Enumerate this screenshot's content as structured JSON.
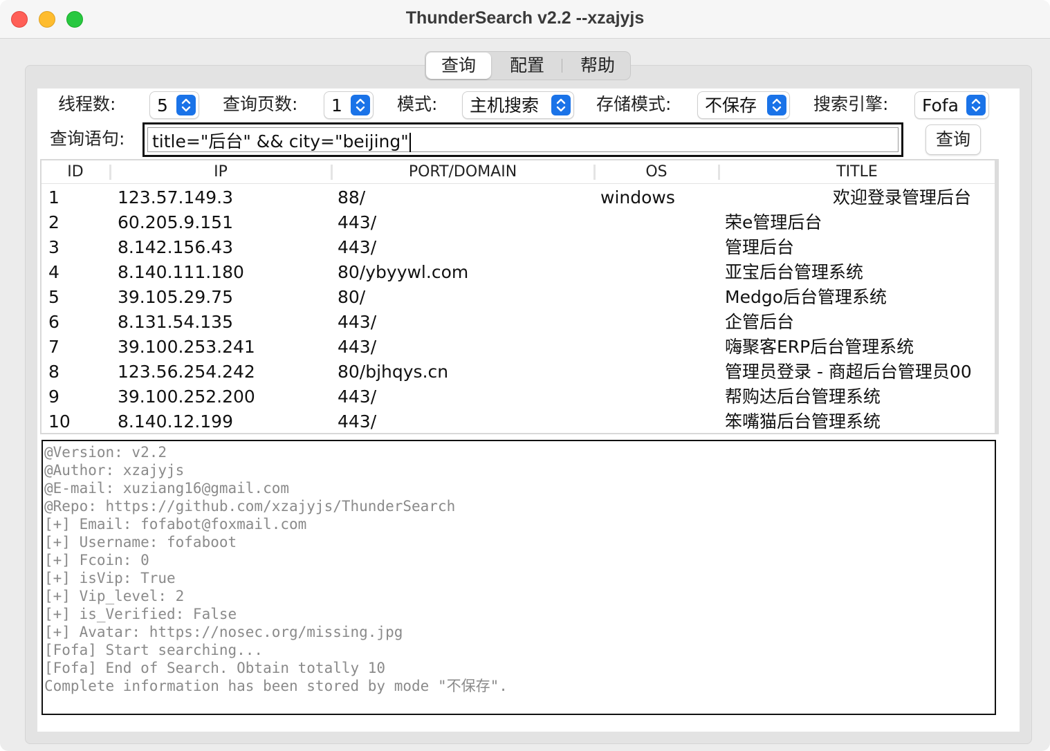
{
  "window": {
    "title": "ThunderSearch v2.2  --xzajyjs"
  },
  "tabs": [
    {
      "label": "查询"
    },
    {
      "label": "配置"
    },
    {
      "label": "帮助"
    }
  ],
  "controls": {
    "threads": {
      "label": "线程数:",
      "value": "5"
    },
    "pages": {
      "label": "查询页数:",
      "value": "1"
    },
    "mode": {
      "label": "模式:",
      "value": "主机搜索"
    },
    "storage": {
      "label": "存储模式:",
      "value": "不保存"
    },
    "engine": {
      "label": "搜索引擎:",
      "value": "Fofa"
    },
    "query": {
      "label": "查询语句:",
      "value": "title=\"后台\" && city=\"beijing\""
    },
    "search_button": "查询"
  },
  "table": {
    "columns": [
      "ID",
      "IP",
      "PORT/DOMAIN",
      "OS",
      "TITLE"
    ],
    "rows": [
      {
        "id": "1",
        "ip": "123.57.149.3",
        "port": "88/",
        "os": "windows",
        "title": "欢迎登录管理后台"
      },
      {
        "id": "2",
        "ip": "60.205.9.151",
        "port": "443/",
        "os": "",
        "title": "荣e管理后台"
      },
      {
        "id": "3",
        "ip": "8.142.156.43",
        "port": "443/",
        "os": "",
        "title": "管理后台"
      },
      {
        "id": "4",
        "ip": "8.140.111.180",
        "port": "80/ybyywl.com",
        "os": "",
        "title": "亚宝后台管理系统"
      },
      {
        "id": "5",
        "ip": "39.105.29.75",
        "port": "80/",
        "os": "",
        "title": "Medgo后台管理系统"
      },
      {
        "id": "6",
        "ip": "8.131.54.135",
        "port": "443/",
        "os": "",
        "title": "企管后台"
      },
      {
        "id": "7",
        "ip": "39.100.253.241",
        "port": "443/",
        "os": "",
        "title": "嗨聚客ERP后台管理系统"
      },
      {
        "id": "8",
        "ip": "123.56.254.242",
        "port": "80/bjhqys.cn",
        "os": "",
        "title": "管理员登录 - 商超后台管理员00"
      },
      {
        "id": "9",
        "ip": "39.100.252.200",
        "port": "443/",
        "os": "",
        "title": "帮购达后台管理系统"
      },
      {
        "id": "10",
        "ip": "8.140.12.199",
        "port": "443/",
        "os": "",
        "title": "笨嘴猫后台管理系统"
      }
    ]
  },
  "log": [
    "@Version: v2.2",
    "@Author: xzajyjs",
    "@E-mail: xuziang16@gmail.com",
    "@Repo: https://github.com/xzajyjs/ThunderSearch",
    "[+] Email: fofabot@foxmail.com",
    "[+] Username: fofaboot",
    "[+] Fcoin: 0",
    "[+] isVip: True",
    "[+] Vip_level: 2",
    "[+] is_Verified: False",
    "[+] Avatar: https://nosec.org/missing.jpg",
    "[Fofa] Start searching...",
    "[Fofa] End of Search. Obtain totally 10",
    "Complete information has been stored by mode \"不保存\"."
  ],
  "colors": {
    "accent": "#1a73e8",
    "close": "#ff5f57",
    "minimize": "#febc2e",
    "zoom": "#28c840",
    "log_text": "#8a8a8a"
  }
}
